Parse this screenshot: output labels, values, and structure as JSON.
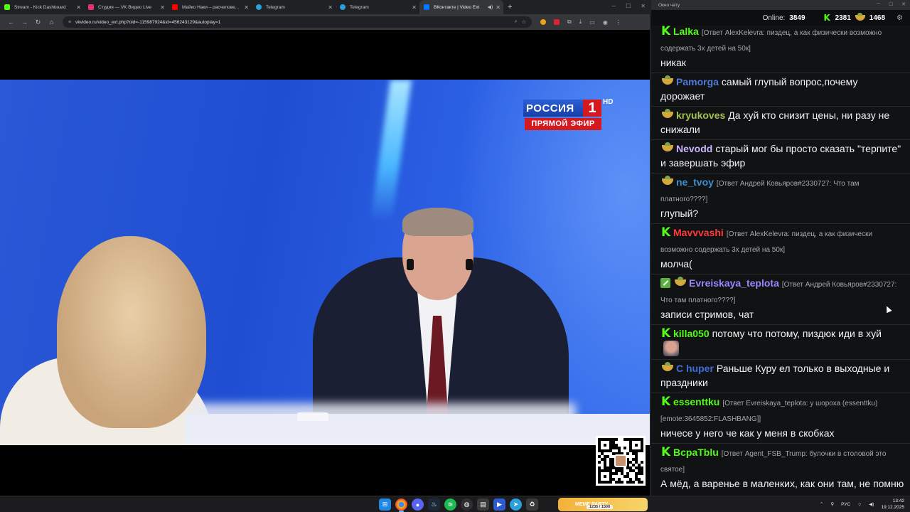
{
  "browser": {
    "tabs": [
      {
        "label": "Stream - Kick Dashboard",
        "color": "#53fc18"
      },
      {
        "label": "Студия — VK Видео Live",
        "color": "#e6316b"
      },
      {
        "label": "Майко Наки – расчеловечив…",
        "color": "#ff0000"
      },
      {
        "label": "Telegram",
        "color": "#2aa1da"
      },
      {
        "label": "Telegram",
        "color": "#2aa1da"
      },
      {
        "label": "ВКонтакте | Video Ext",
        "color": "#0077ff",
        "active": true
      }
    ],
    "url": "vkvideo.ru/video_ext.php?oid=-115987924&id=456243129&autoplay=1"
  },
  "video": {
    "channel_logo": {
      "name": "РОССИЯ",
      "number": "1",
      "hd": "HD",
      "live": "ПРЯМОЙ ЭФИР"
    }
  },
  "chat": {
    "window_title": "Окно чату",
    "online_label": "Online:",
    "online_count": "3849",
    "kick_count": "2381",
    "bowl_count": "1468",
    "messages": [
      {
        "badge": "kick",
        "name": "Lalka",
        "name_color": "#53fc18",
        "reply": "[Ответ AlexKelevra: пиздец, а как физически возможно содержать 3х детей на 50к]",
        "text": "никак"
      },
      {
        "badge": "bowl",
        "name": "Pamorga",
        "name_color": "#4f7ad8",
        "reply": "",
        "text": "самый глупый вопрос,почему дорожает"
      },
      {
        "badge": "bowl",
        "name": "kryukoves",
        "name_color": "#a4c24e",
        "reply": "",
        "text": "Да хуй кто снизит цены, ни разу не снижали"
      },
      {
        "badge": "bowl",
        "name": "Nevodd",
        "name_color": "#c9b6ff",
        "reply": "",
        "text": "старый мог бы просто сказать \"терпите\" и завершать эфир"
      },
      {
        "badge": "bowl",
        "name": "ne_tvoy",
        "name_color": "#3f8fd2",
        "reply": "[Ответ Андрей Ковьяров#2330727: Что там платного????]",
        "text": "глупый?"
      },
      {
        "badge": "kick",
        "name": "Mavvvashi",
        "name_color": "#ff3b3b",
        "reply": "[Ответ AlexKelevra: пиздец, а как физически возможно содержать 3х детей на 50к]",
        "text": "молча("
      },
      {
        "badge": "edit-bowl",
        "name": "Evreiskaya_teplota",
        "name_color": "#9a86ff",
        "reply": "[Ответ Андрей Ковьяров#2330727: Что там платного????]",
        "text": "записи стримов, чат"
      },
      {
        "badge": "kick",
        "name": "killa050",
        "name_color": "#53fc18",
        "reply": "",
        "text": "потому что потому, пиздюк иди в хуй"
      },
      {
        "badge": "bowl",
        "name": "C huper",
        "name_color": "#3f6ed8",
        "reply": "",
        "text": "Раньше Куру ел только в выходные и праздники"
      },
      {
        "badge": "kick",
        "name": "essenttku",
        "name_color": "#53fc18",
        "reply": "[Ответ Evreiskaya_teplota: у шороха (essenttku) [emote:3645852:FLASHBANG]]",
        "text": "ничесе у него че как у меня в скобках"
      },
      {
        "badge": "kick",
        "name": "BcpaTblu",
        "name_color": "#53fc18",
        "reply": "[Ответ Agent_FSB_Trump: булочки в столовой это святое]",
        "text": "А мёд, а варенье в маленких, как они там, не помню называются как, упаковки."
      }
    ]
  },
  "taskbar": {
    "widget_title": "MEME PARTY",
    "widget_sub": "1235 / 1500",
    "lang": "РУС",
    "time": "13:42",
    "date": "19.12.2025"
  }
}
